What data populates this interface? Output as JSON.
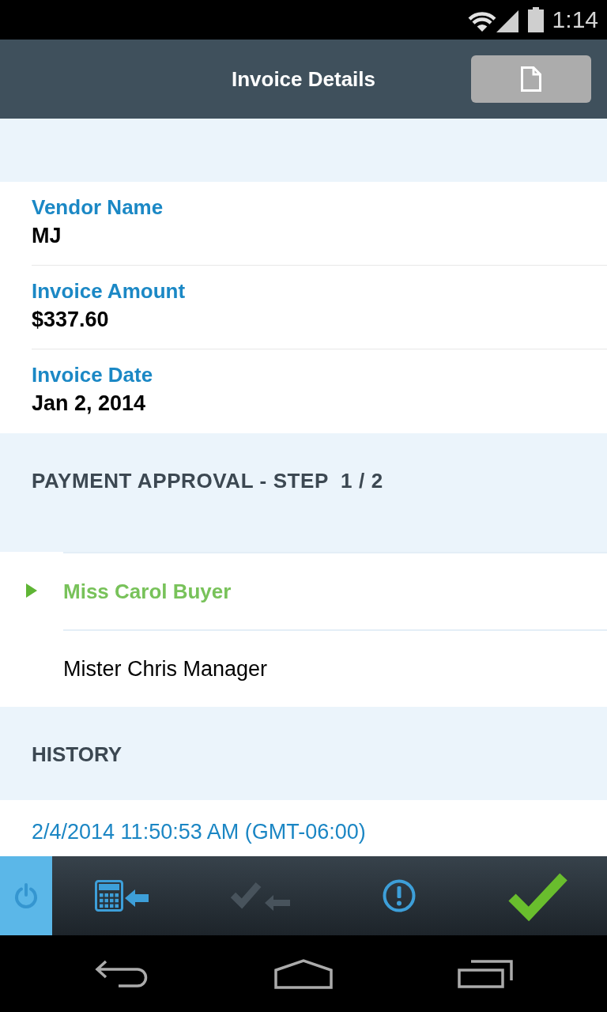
{
  "status_bar": {
    "time": "1:14"
  },
  "header": {
    "title": "Invoice Details"
  },
  "fields": [
    {
      "label": "Vendor Name",
      "value": "MJ"
    },
    {
      "label": "Invoice Amount",
      "value": "$337.60"
    },
    {
      "label": "Invoice Date",
      "value": "Jan 2, 2014"
    }
  ],
  "approval": {
    "heading": "PAYMENT APPROVAL - STEP  1 / 2",
    "approvers": [
      {
        "name": "Miss Carol Buyer",
        "current": true
      },
      {
        "name": "Mister Chris Manager",
        "current": false
      }
    ]
  },
  "history": {
    "heading": "HISTORY",
    "entries": [
      {
        "timestamp": "2/4/2014 11:50:53 AM (GMT-06:00)"
      }
    ]
  },
  "toolbar": [
    {
      "kind": "power",
      "selected": true,
      "disabled": false
    },
    {
      "kind": "calculator",
      "selected": false,
      "disabled": false
    },
    {
      "kind": "recall",
      "selected": false,
      "disabled": true
    },
    {
      "kind": "alert",
      "selected": false,
      "disabled": false
    },
    {
      "kind": "approve",
      "selected": false,
      "disabled": false
    }
  ]
}
